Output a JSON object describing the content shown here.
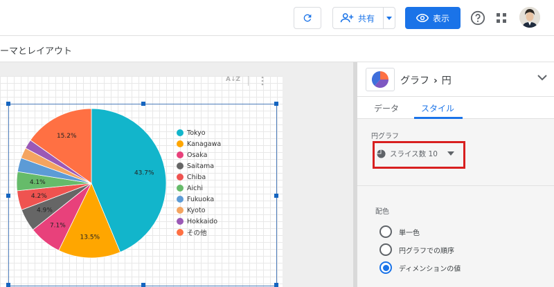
{
  "header": {
    "share_label": "共有",
    "view_label": "表示"
  },
  "toolbar": {
    "theme_layout_label": "ーマとレイアウト"
  },
  "chart_data": {
    "type": "pie",
    "categories": [
      "Tokyo",
      "Kanagawa",
      "Osaka",
      "Saitama",
      "Chiba",
      "Aichi",
      "Fukuoka",
      "Kyoto",
      "Hokkaido",
      "その他"
    ],
    "values": [
      43.7,
      13.5,
      7.1,
      4.9,
      4.2,
      4.1,
      3.0,
      2.3,
      2.0,
      15.2
    ],
    "value_labels": [
      "43.7%",
      "13.5%",
      "7.1%",
      "4.9%",
      "4.2%",
      "4.1%",
      "",
      "",
      "",
      "15.2%"
    ],
    "colors": [
      "#12b5cb",
      "#ffa600",
      "#e8417b",
      "#666666",
      "#ef5350",
      "#66bb6a",
      "#5c9bd6",
      "#f4a460",
      "#9b59b6",
      "#ff7043"
    ]
  },
  "panel": {
    "chart_kind": "グラフ",
    "chart_subtype": "円",
    "tabs": [
      {
        "label": "データ"
      },
      {
        "label": "スタイル"
      }
    ],
    "pie_section_label": "円グラフ",
    "slices_label": "スライス数 10",
    "color_section_label": "配色",
    "color_options": [
      {
        "label": "単一色",
        "checked": false
      },
      {
        "label": "円グラフでの順序",
        "checked": false
      },
      {
        "label": "ディメンションの値",
        "checked": true
      }
    ]
  }
}
